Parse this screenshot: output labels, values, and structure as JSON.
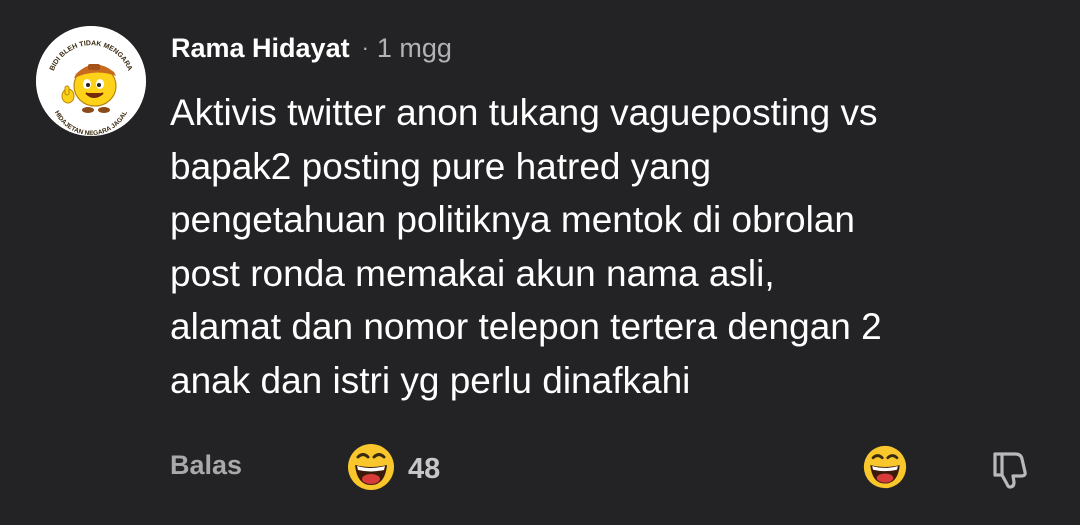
{
  "comment": {
    "author": "Rama Hidayat",
    "separator": "·",
    "time": "1 mgg",
    "text": "Aktivis twitter anon tukang vagueposting vs\nbapak2 posting pure hatred yang\npengetahuan politiknya mentok di obrolan\npost ronda memakai akun nama asli,\nalamat dan nomor telepon tertera dengan 2\nanak dan istri yg perlu dinafkahi",
    "avatar": {
      "top_text": "BIDI BLEH TIDAK MENGARA",
      "bottom_text": "HIDAJETAN NEGARA JAGAL"
    }
  },
  "actions": {
    "reply_label": "Balas",
    "reaction_icon": "grinning-face-emoji",
    "reaction_count": "48",
    "react_button_icon": "grinning-face-emoji",
    "dislike_icon": "thumbs-down-icon"
  },
  "colors": {
    "background": "#232325",
    "text_primary": "#ffffff",
    "text_secondary": "#a9a9ab",
    "emoji_yellow": "#f9c62b",
    "emoji_mouth": "#d93a3a"
  }
}
